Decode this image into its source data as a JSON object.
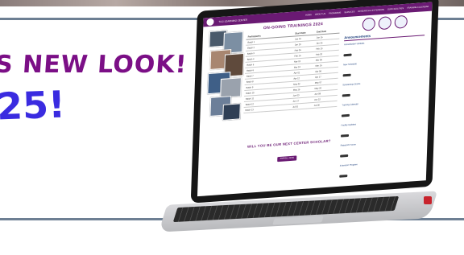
{
  "headline": {
    "line1": "S NEW LOOK!",
    "line2": "25!"
  },
  "site": {
    "name": "TCG LEARNING CENTER",
    "nav": [
      "HOME",
      "ABOUT US",
      "PROGRAMS",
      "SERVICES",
      "RESEARCH & EXTENSION",
      "OUR FACILITIES",
      "TRAINING CALENDAR"
    ]
  },
  "main": {
    "title": "ON-GOING TRAININGS 2024",
    "columns": [
      "Participants",
      "Start Date",
      "End Date"
    ],
    "rows": [
      [
        "Batch 1",
        "Jan 10",
        "Jan 15"
      ],
      [
        "Batch 2",
        "Jan 20",
        "Jan 25"
      ],
      [
        "Batch 3",
        "Feb 05",
        "Feb 10"
      ],
      [
        "Batch 4",
        "Feb 15",
        "Feb 20"
      ],
      [
        "Batch 5",
        "Mar 01",
        "Mar 06"
      ],
      [
        "Batch 6",
        "Mar 10",
        "Mar 15"
      ],
      [
        "Batch 7",
        "Apr 01",
        "Apr 06"
      ],
      [
        "Batch 8",
        "Apr 12",
        "Apr 17"
      ],
      [
        "Batch 9",
        "May 02",
        "May 07"
      ],
      [
        "Batch 10",
        "May 15",
        "May 20"
      ],
      [
        "Batch 11",
        "Jun 03",
        "Jun 08"
      ],
      [
        "Batch 12",
        "Jun 17",
        "Jun 22"
      ],
      [
        "Batch 13",
        "Jul 01",
        "Jul 06"
      ]
    ],
    "cta_title": "WILL YOU BE OUR NEXT CENTER SCHOLAR?",
    "cta_button": "ENROLL NOW"
  },
  "sidebar": {
    "title": "Announcements",
    "items": [
      "Accreditation Updates",
      "New Schedule",
      "Scholarship Grants",
      "Training Calendar",
      "Facility Updates",
      "Research Forum",
      "Extension Program"
    ]
  },
  "colors": {
    "purple": "#6a1a73",
    "blue": "#3a2be0",
    "navy": "#1b3d7a"
  }
}
